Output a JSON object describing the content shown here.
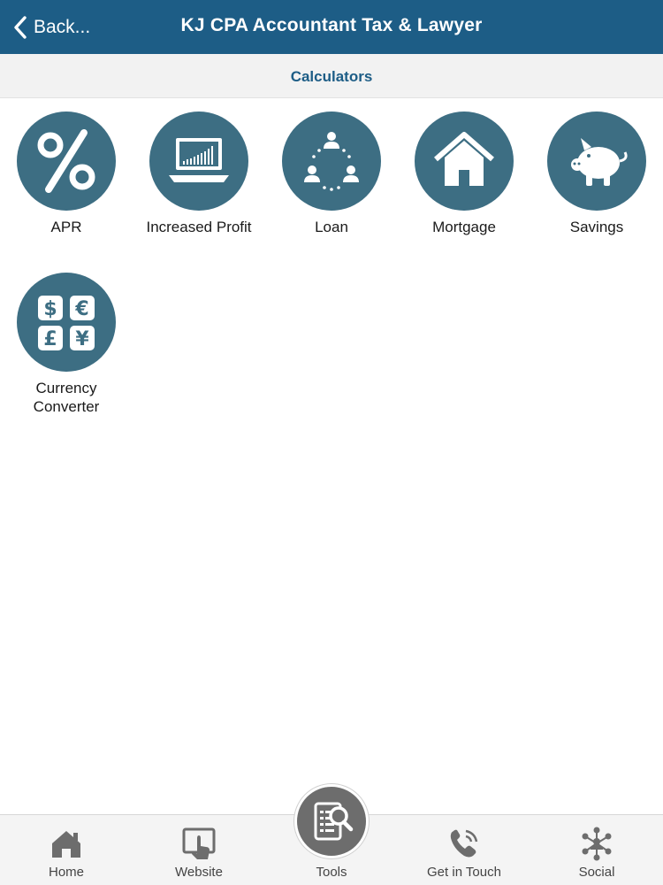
{
  "header": {
    "back_label": "Back...",
    "title": "KJ CPA Accountant Tax & Lawyer"
  },
  "section": {
    "title": "Calculators"
  },
  "calculators": [
    {
      "label": "APR",
      "icon": "percent-icon"
    },
    {
      "label": "Increased Profit",
      "icon": "laptop-chart-icon"
    },
    {
      "label": "Loan",
      "icon": "people-cycle-icon"
    },
    {
      "label": "Mortgage",
      "icon": "house-icon"
    },
    {
      "label": "Savings",
      "icon": "piggy-bank-icon"
    },
    {
      "label": "Currency\nConverter",
      "icon": "currency-icon"
    }
  ],
  "tabbar": {
    "items": [
      {
        "label": "Home",
        "icon": "home-icon"
      },
      {
        "label": "Website",
        "icon": "website-touch-icon"
      },
      {
        "label": "Tools",
        "icon": "tools-icon"
      },
      {
        "label": "Get in Touch",
        "icon": "phone-icon"
      },
      {
        "label": "Social",
        "icon": "social-network-icon"
      }
    ]
  },
  "colors": {
    "header_bg": "#1d5d86",
    "tile_circle": "#3d6e83",
    "subtitle": "#1d5d86",
    "tab_icon": "#6d6d6d"
  }
}
